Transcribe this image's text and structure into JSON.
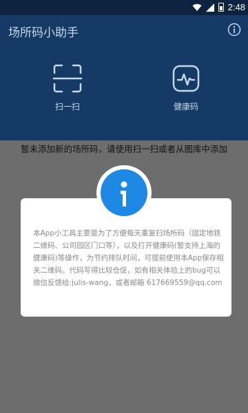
{
  "status_bar": {
    "time": "2:48"
  },
  "app_bar": {
    "title": "场所码小助手",
    "info_icon": "info-circle-icon"
  },
  "actions": {
    "scan_label": "扫一扫",
    "health_label": "健康码",
    "scan_icon": "scan-icon",
    "health_icon": "health-code-icon"
  },
  "empty_state": {
    "message": "暂未添加新的场所码，请使用扫一扫或者从图库中添加"
  },
  "dialog": {
    "icon": "info-icon",
    "body": "本App小工具主要是为了方便每天重复扫场所码（固定地铁二维码、公司园区门口等），以及打开健康码(暂支持上海的健康码)等操作，为节约排队时间，可提前使用本App保存相关二维码。代码写得比较仓促，如有相关体验上的bug可以微信反馈给:julis-wang，或者邮箱 617669559@qq.com"
  },
  "colors": {
    "app_bar": "#163a66",
    "status_bar": "#0d2340",
    "overlay": "#6d6d6d",
    "accent": "#1e88e5"
  }
}
